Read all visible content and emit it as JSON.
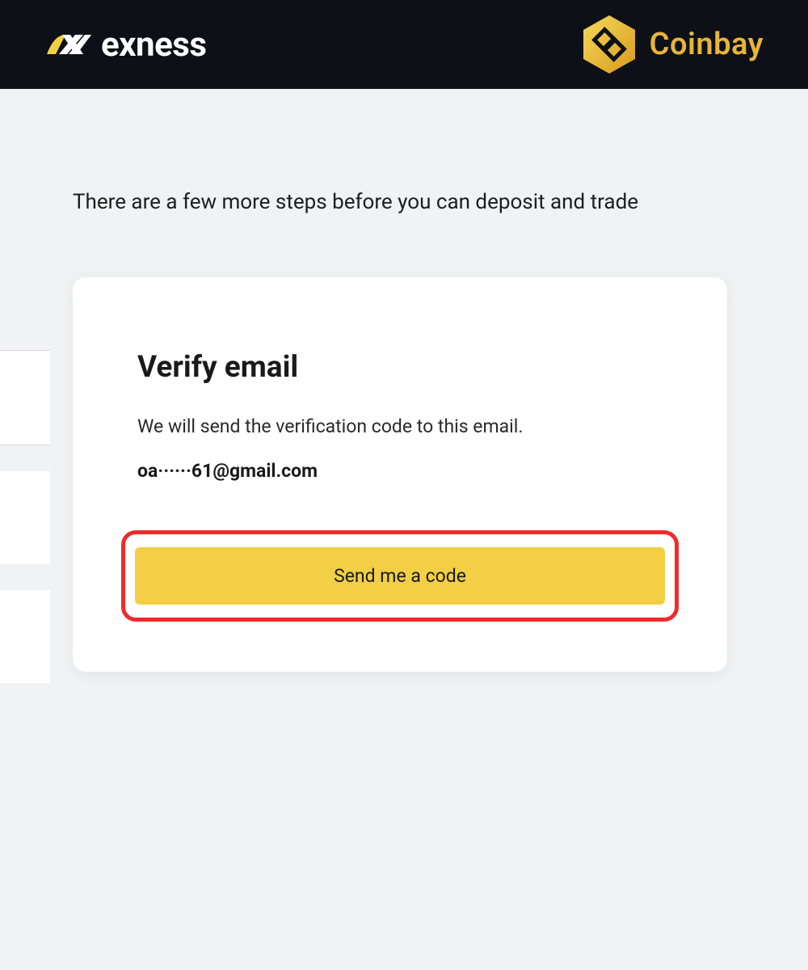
{
  "header": {
    "brand1_name": "exness",
    "brand2_name": "Coinbay"
  },
  "intro": "There are a few more steps before you can deposit and trade",
  "card": {
    "title": "Verify email",
    "description": "We will send the verification code to this email.",
    "email": "oa······61@gmail.com",
    "button_label": "Send me a code"
  },
  "colors": {
    "header_bg": "#0d1117",
    "accent_gold": "#e8b43a",
    "button_bg": "#f2cf44",
    "highlight_border": "#ef2b2b"
  }
}
